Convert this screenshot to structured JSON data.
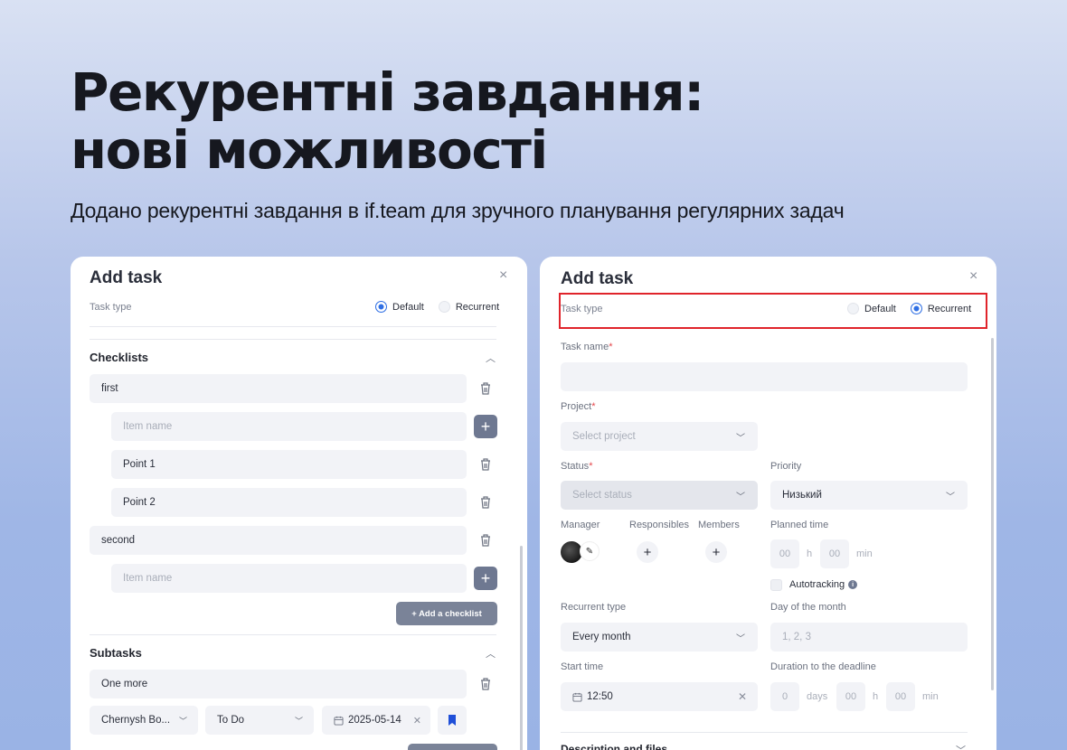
{
  "hero": {
    "title": "Рекурентні завдання:\nнові можливості",
    "subtitle": "Додано рекурентні завдання в if.team для зручного планування регулярних задач"
  },
  "left_panel": {
    "title": "Add task",
    "close": "×",
    "task_type_label": "Task type",
    "radio_default": "Default",
    "radio_recurrent": "Recurrent",
    "selected": "Default",
    "checklists_title": "Checklists",
    "checklists": [
      {
        "name": "first",
        "item_placeholder": "Item name",
        "points": [
          "Point 1",
          "Point 2"
        ]
      },
      {
        "name": "second",
        "item_placeholder": "Item name",
        "points": []
      }
    ],
    "add_checklist": "+ Add a checklist",
    "subtasks_title": "Subtasks",
    "subtask": {
      "name": "One more",
      "assignee": "Chernysh Bo...",
      "status": "To Do",
      "date": "2025-05-14"
    }
  },
  "right_panel": {
    "title": "Add task",
    "close": "×",
    "task_type_label": "Task type",
    "radio_default": "Default",
    "radio_recurrent": "Recurrent",
    "selected": "Recurrent",
    "task_name_label": "Task name",
    "task_name_value": "",
    "project_label": "Project",
    "project_placeholder": "Select project",
    "status_label": "Status",
    "status_placeholder": "Select status",
    "priority_label": "Priority",
    "priority_value": "Низький",
    "manager_label": "Manager",
    "responsibles_label": "Responsibles",
    "members_label": "Members",
    "planned_time_label": "Planned time",
    "planned_hours": "00",
    "planned_h_unit": "h",
    "planned_minutes": "00",
    "planned_min_unit": "min",
    "autotracking_label": "Autotracking",
    "recurrent_type_label": "Recurrent type",
    "recurrent_type_value": "Every month",
    "day_of_month_label": "Day of the month",
    "day_of_month_placeholder": "1, 2, 3",
    "start_time_label": "Start time",
    "start_time_value": "12:50",
    "duration_label": "Duration to the deadline",
    "duration_days": "0",
    "duration_days_unit": "days",
    "duration_hours": "00",
    "duration_h_unit": "h",
    "duration_minutes": "00",
    "duration_min_unit": "min",
    "description_title": "Description and files"
  },
  "colors": {
    "accent": "#2f6fe4",
    "highlight_frame": "#e0242b",
    "button_dark": "#7a8398",
    "field_bg": "#f2f3f7"
  }
}
